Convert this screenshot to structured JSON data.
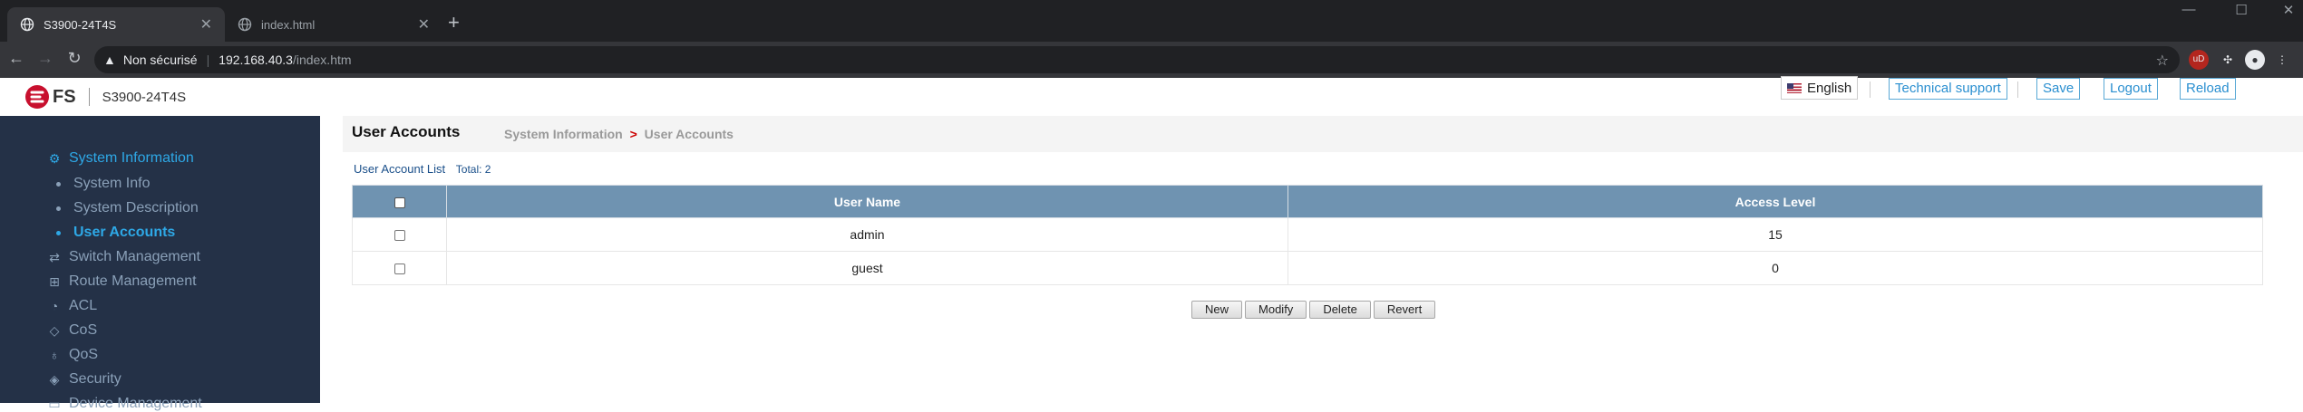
{
  "browser": {
    "tabs": [
      {
        "title": "S3900-24T4S",
        "active": true
      },
      {
        "title": "index.html",
        "active": false
      }
    ],
    "new_tab": "+",
    "address": {
      "security_label": "Non sécurisé",
      "host": "192.168.40.3",
      "path": "/index.htm"
    },
    "window_controls": {
      "minimize": "—",
      "maximize": "☐",
      "close": "✕"
    },
    "extension_badge": "uD"
  },
  "header": {
    "logo_text": "FS",
    "device_name": "S3900-24T4S",
    "language": "English",
    "technical_support": "Technical support",
    "save": "Save",
    "logout": "Logout",
    "reload": "Reload"
  },
  "sidebar": {
    "items": [
      {
        "label": "System Information",
        "icon": "gear-icon",
        "active": true,
        "children": [
          {
            "label": "System Info",
            "active": false
          },
          {
            "label": "System Description",
            "active": false
          },
          {
            "label": "User Accounts",
            "active": true
          }
        ]
      },
      {
        "label": "Switch Management",
        "icon": "switch-icon"
      },
      {
        "label": "Route Management",
        "icon": "route-icon"
      },
      {
        "label": "ACL",
        "icon": "acl-icon"
      },
      {
        "label": "CoS",
        "icon": "cos-icon"
      },
      {
        "label": "QoS",
        "icon": "qos-icon"
      },
      {
        "label": "Security",
        "icon": "shield-icon"
      },
      {
        "label": "Device Management",
        "icon": "device-icon"
      }
    ]
  },
  "main": {
    "title": "User Accounts",
    "breadcrumb": {
      "parent": "System Information",
      "separator": ">",
      "current": "User Accounts"
    },
    "list_title": "User Account List",
    "total_label": "Total: 2",
    "columns": [
      "User Name",
      "Access Level"
    ],
    "rows": [
      {
        "user": "admin",
        "level": "15"
      },
      {
        "user": "guest",
        "level": "0"
      }
    ],
    "buttons": {
      "new": "New",
      "modify": "Modify",
      "delete": "Delete",
      "revert": "Revert"
    }
  },
  "colors": {
    "sidebar_bg": "#243147",
    "accent": "#2ea8e6",
    "table_header": "#6f93b1",
    "header_button_border": "#5aa9d6"
  }
}
